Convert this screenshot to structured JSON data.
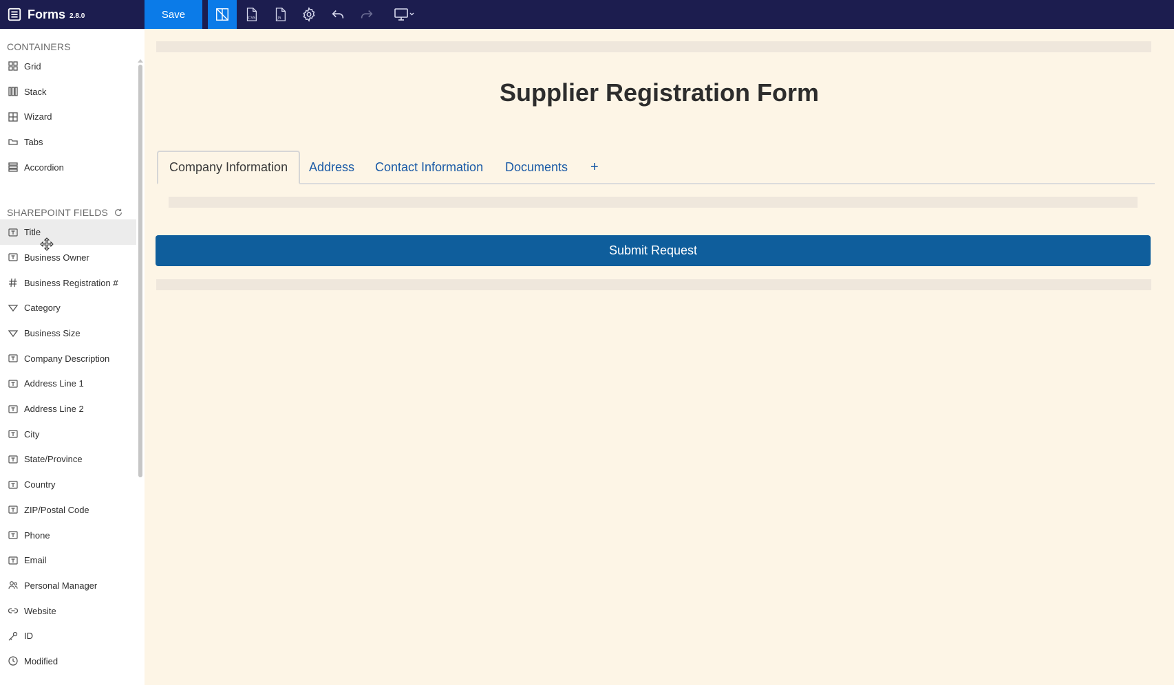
{
  "app": {
    "name": "Forms",
    "version": "2.8.0"
  },
  "toolbar": {
    "save_label": "Save",
    "tools": [
      "layout-icon",
      "css-icon",
      "js-icon",
      "settings-icon",
      "undo-icon",
      "redo-icon",
      "device-preview-icon"
    ]
  },
  "sidebar": {
    "containers_title": "CONTAINERS",
    "containers": [
      {
        "label": "Grid",
        "icon": "grid-icon"
      },
      {
        "label": "Stack",
        "icon": "stack-icon"
      },
      {
        "label": "Wizard",
        "icon": "wizard-icon"
      },
      {
        "label": "Tabs",
        "icon": "tabs-icon"
      },
      {
        "label": "Accordion",
        "icon": "accordion-icon"
      }
    ],
    "fields_title": "SHAREPOINT FIELDS",
    "fields": [
      {
        "label": "Title",
        "icon": "text-field-icon"
      },
      {
        "label": "Business Owner",
        "icon": "text-field-icon"
      },
      {
        "label": "Business Registration #",
        "icon": "number-icon"
      },
      {
        "label": "Category",
        "icon": "choice-icon"
      },
      {
        "label": "Business Size",
        "icon": "choice-icon"
      },
      {
        "label": "Company Description",
        "icon": "text-field-icon"
      },
      {
        "label": "Address Line 1",
        "icon": "text-field-icon"
      },
      {
        "label": "Address Line 2",
        "icon": "text-field-icon"
      },
      {
        "label": "City",
        "icon": "text-field-icon"
      },
      {
        "label": "State/Province",
        "icon": "text-field-icon"
      },
      {
        "label": "Country",
        "icon": "text-field-icon"
      },
      {
        "label": "ZIP/Postal Code",
        "icon": "text-field-icon"
      },
      {
        "label": "Phone",
        "icon": "text-field-icon"
      },
      {
        "label": "Email",
        "icon": "text-field-icon"
      },
      {
        "label": "Personal Manager",
        "icon": "person-icon"
      },
      {
        "label": "Website",
        "icon": "link-icon"
      },
      {
        "label": "ID",
        "icon": "key-icon"
      },
      {
        "label": "Modified",
        "icon": "clock-icon"
      }
    ]
  },
  "form": {
    "title": "Supplier Registration Form",
    "tabs": [
      {
        "label": "Company Information",
        "active": true
      },
      {
        "label": "Address",
        "active": false
      },
      {
        "label": "Contact Information",
        "active": false
      },
      {
        "label": "Documents",
        "active": false
      }
    ],
    "add_tab_label": "+",
    "submit_label": "Submit Request"
  },
  "colors": {
    "topbar": "#1c1d4f",
    "accent": "#0b7be8",
    "canvas": "#fdf5e6",
    "submit": "#0f5e9c",
    "tab_link": "#1a5aa6"
  }
}
